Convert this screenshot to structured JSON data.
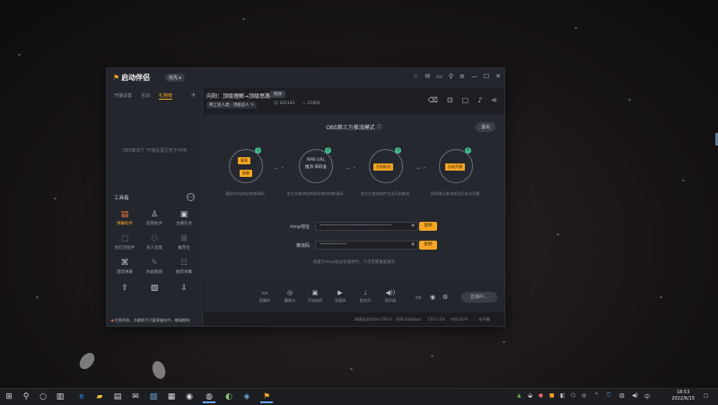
{
  "app": {
    "name": "启动伴侣",
    "version_badge": "抢先 ▸"
  },
  "sidebar": {
    "tabs": [
      "开播设置",
      "互动",
      "礼物榜"
    ],
    "empty_text": "OBS推流下 开播设置区暂不可用",
    "tools_title": "工具箱",
    "tools": [
      {
        "label": "弹幕助手",
        "icon": "danmaku-icon"
      },
      {
        "label": "房管助手",
        "icon": "user-icon"
      },
      {
        "label": "主播任务",
        "icon": "task-icon"
      },
      {
        "label": "抢红包助手",
        "icon": "redpacket-icon"
      },
      {
        "label": "多人连麦",
        "icon": "multi-link-icon"
      },
      {
        "label": "推荐位",
        "icon": "new-icon"
      },
      {
        "label": "游戏弹幕",
        "icon": "game-icon"
      },
      {
        "label": "你画我猜",
        "icon": "draw-icon"
      },
      {
        "label": "推荐弹幕",
        "icon": "recommend-icon"
      },
      {
        "label": "",
        "icon": "upload-icon"
      },
      {
        "label": "",
        "icon": "image-icon"
      },
      {
        "label": "",
        "icon": "download-icon"
      }
    ],
    "footer_text": "礼物消息、点歌助手已暂停服务中，敬请期待"
  },
  "header": {
    "room_title": "向阳：顶级理解→顶级思路",
    "room_action": "修改",
    "category": "网上追人类 · 顶级追人",
    "fans": "165103",
    "hot": "21850"
  },
  "panel": {
    "mode_title": "OBS第三方推流模式",
    "exit_label": "退出",
    "steps": [
      {
        "num": "1",
        "chips": [
          "复制",
          "复制"
        ],
        "caption": "复制rtmp地址和推流码"
      },
      {
        "num": "2",
        "text": "RMS URL\n推流·串码准",
        "caption": "第三方推流软件粘贴地址和推流码"
      },
      {
        "num": "3",
        "chips": [
          "开始推流"
        ],
        "caption": "第三方推流软件点击开始推流"
      },
      {
        "num": "4",
        "chips": [
          "自动开播"
        ],
        "caption": "伴侣确认推流成功后自动开播"
      }
    ],
    "fields": [
      {
        "label": "rtmp地址",
        "value": "••••••••••••••••••••••••••••••••••",
        "copy": "复制"
      },
      {
        "label": "推流码",
        "value": "•••••••••••••",
        "copy": "复制"
      }
    ],
    "hint": "未提示rtmp地址有变更时，下次无需重复填写"
  },
  "bottom_tools": [
    {
      "label": "直播间",
      "icon": "screen-icon"
    },
    {
      "label": "摄像头",
      "icon": "camera-icon"
    },
    {
      "label": "开始投屏",
      "icon": "cast-icon"
    },
    {
      "label": "多媒体",
      "icon": "media-icon"
    },
    {
      "label": "麦克风",
      "icon": "mic-icon"
    },
    {
      "label": "扬声器",
      "icon": "speaker-icon"
    }
  ],
  "live_button": "直播中...",
  "statusbar": [
    "网络延迟(0ms)",
    "FPS:0",
    "码率:0(0kbps)",
    "CPU:11%",
    "内存:51%",
    "未开播"
  ],
  "taskbar": {
    "time": "18:53",
    "date": "2022/6/15"
  }
}
